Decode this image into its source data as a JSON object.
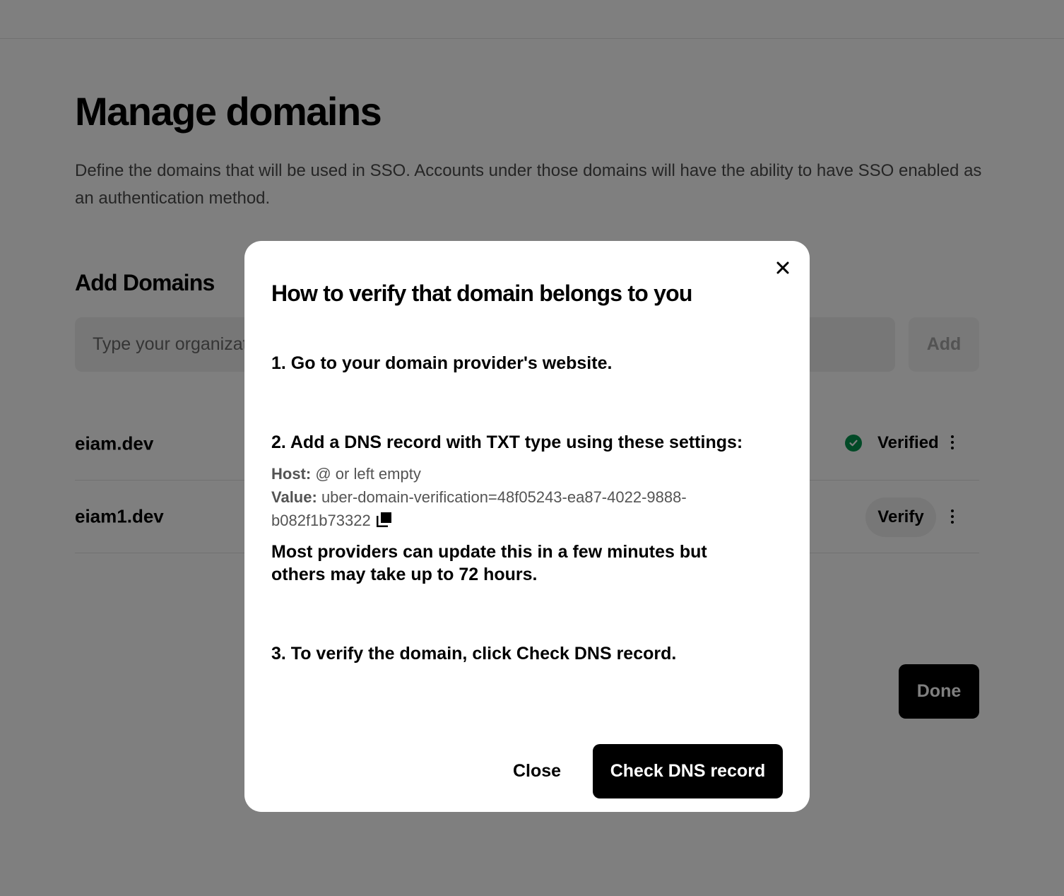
{
  "page": {
    "title": "Manage domains",
    "description": "Define the domains that will be used in SSO. Accounts under those domains will have the ability to have SSO enabled as an authentication method."
  },
  "add_domains": {
    "title": "Add Domains",
    "input_placeholder": "Type your organization's domain",
    "add_label": "Add"
  },
  "domains": [
    {
      "name": "eiam.dev",
      "status": "Verified",
      "status_icon": "check-circle-icon"
    },
    {
      "name": "eiam1.dev",
      "action_label": "Verify"
    }
  ],
  "done_label": "Done",
  "modal": {
    "title": "How to verify that domain belongs to you",
    "step1": "1. Go to your domain provider's website.",
    "step2": "2. Add a DNS record with TXT type using these settings:",
    "host_label": "Host:",
    "host_value": "@ or left empty",
    "value_label": "Value:",
    "value_text": "uber-domain-verification=48f05243-ea87-4022-9888-b082f1b73322",
    "copy_icon": "copy-icon",
    "note": "Most providers can update this in a few minutes but others may take up to 72 hours.",
    "step3": "3. To verify the domain, click Check DNS record.",
    "close_label": "Close",
    "check_label": "Check DNS record"
  },
  "colors": {
    "accent": "#000000",
    "verified_green": "#05944f",
    "overlay": "rgba(0,0,0,0.5)"
  }
}
